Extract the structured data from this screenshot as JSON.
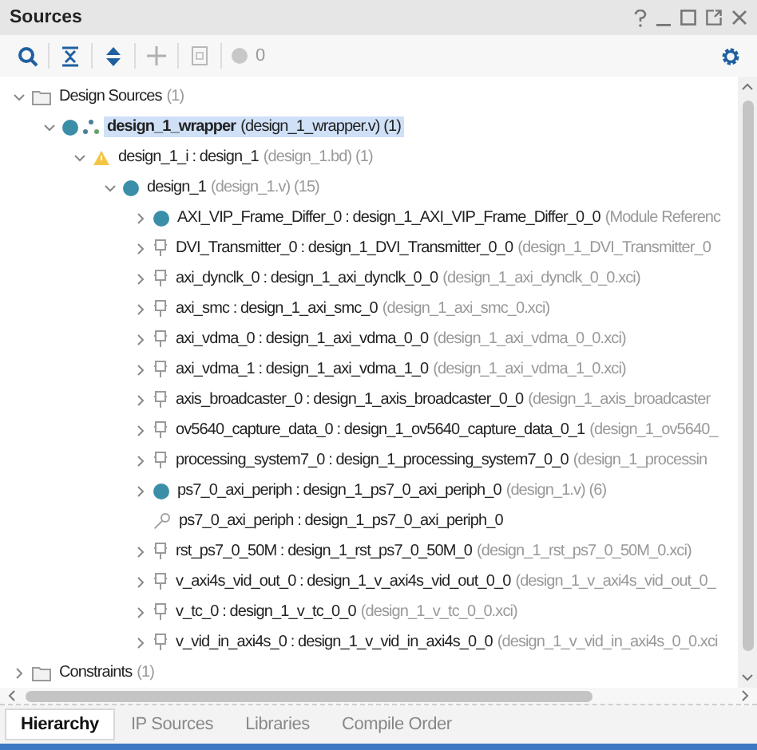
{
  "window": {
    "title": "Sources"
  },
  "toolbar": {
    "count": "0"
  },
  "tree": [
    {
      "label": "Design Sources",
      "detail": "(1)",
      "kind": "folder",
      "expanded": true,
      "selected": false,
      "top": false,
      "children": [
        {
          "label": "design_1_wrapper",
          "detail": "(design_1_wrapper.v) (1)",
          "kind": "top-module",
          "expanded": true,
          "selected": true,
          "top": true,
          "children": [
            {
              "label": "design_1_i : design_1",
              "detail": "(design_1.bd) (1)",
              "kind": "block-design",
              "expanded": true,
              "selected": false,
              "top": false,
              "children": [
                {
                  "label": "design_1",
                  "detail": "(design_1.v) (15)",
                  "kind": "module",
                  "expanded": true,
                  "selected": false,
                  "top": false,
                  "children": [
                    {
                      "label": "AXI_VIP_Frame_Differ_0 : design_1_AXI_VIP_Frame_Differ_0_0",
                      "detail": "(Module Referenc",
                      "kind": "module",
                      "expanded": false,
                      "selected": false,
                      "top": false
                    },
                    {
                      "label": "DVI_Transmitter_0 : design_1_DVI_Transmitter_0_0",
                      "detail": "(design_1_DVI_Transmitter_0",
                      "kind": "ip",
                      "expanded": false,
                      "selected": false,
                      "top": false
                    },
                    {
                      "label": "axi_dynclk_0 : design_1_axi_dynclk_0_0",
                      "detail": "(design_1_axi_dynclk_0_0.xci)",
                      "kind": "ip",
                      "expanded": false,
                      "selected": false,
                      "top": false
                    },
                    {
                      "label": "axi_smc : design_1_axi_smc_0",
                      "detail": "(design_1_axi_smc_0.xci)",
                      "kind": "ip",
                      "expanded": false,
                      "selected": false,
                      "top": false
                    },
                    {
                      "label": "axi_vdma_0 : design_1_axi_vdma_0_0",
                      "detail": "(design_1_axi_vdma_0_0.xci)",
                      "kind": "ip",
                      "expanded": false,
                      "selected": false,
                      "top": false
                    },
                    {
                      "label": "axi_vdma_1 : design_1_axi_vdma_1_0",
                      "detail": "(design_1_axi_vdma_1_0.xci)",
                      "kind": "ip",
                      "expanded": false,
                      "selected": false,
                      "top": false
                    },
                    {
                      "label": "axis_broadcaster_0 : design_1_axis_broadcaster_0_0",
                      "detail": "(design_1_axis_broadcaster",
                      "kind": "ip",
                      "expanded": false,
                      "selected": false,
                      "top": false
                    },
                    {
                      "label": "ov5640_capture_data_0 : design_1_ov5640_capture_data_0_1",
                      "detail": "(design_1_ov5640_",
                      "kind": "ip",
                      "expanded": false,
                      "selected": false,
                      "top": false
                    },
                    {
                      "label": "processing_system7_0 : design_1_processing_system7_0_0",
                      "detail": "(design_1_processin",
                      "kind": "ip",
                      "expanded": false,
                      "selected": false,
                      "top": false
                    },
                    {
                      "label": "ps7_0_axi_periph : design_1_ps7_0_axi_periph_0",
                      "detail": "(design_1.v) (6)",
                      "kind": "module",
                      "expanded": false,
                      "selected": false,
                      "top": false
                    },
                    {
                      "label": "ps7_0_axi_periph : design_1_ps7_0_axi_periph_0",
                      "kind": "reference",
                      "selected": false,
                      "top": false
                    },
                    {
                      "label": "rst_ps7_0_50M : design_1_rst_ps7_0_50M_0",
                      "detail": "(design_1_rst_ps7_0_50M_0.xci)",
                      "kind": "ip",
                      "expanded": false,
                      "selected": false,
                      "top": false
                    },
                    {
                      "label": "v_axi4s_vid_out_0 : design_1_v_axi4s_vid_out_0_0",
                      "detail": "(design_1_v_axi4s_vid_out_0_",
                      "kind": "ip",
                      "expanded": false,
                      "selected": false,
                      "top": false
                    },
                    {
                      "label": "v_tc_0 : design_1_v_tc_0_0",
                      "detail": "(design_1_v_tc_0_0.xci)",
                      "kind": "ip",
                      "expanded": false,
                      "selected": false,
                      "top": false
                    },
                    {
                      "label": "v_vid_in_axi4s_0 : design_1_v_vid_in_axi4s_0_0",
                      "detail": "(design_1_v_vid_in_axi4s_0_0.xci",
                      "kind": "ip",
                      "expanded": false,
                      "selected": false,
                      "top": false
                    }
                  ]
                }
              ]
            }
          ]
        }
      ]
    },
    {
      "label": "Constraints",
      "detail": "(1)",
      "kind": "folder",
      "expanded": false,
      "selected": false,
      "top": false
    }
  ],
  "tabs": [
    {
      "label": "Hierarchy",
      "selected": true
    },
    {
      "label": "IP Sources",
      "selected": false
    },
    {
      "label": "Libraries",
      "selected": false
    },
    {
      "label": "Compile Order",
      "selected": false
    }
  ]
}
